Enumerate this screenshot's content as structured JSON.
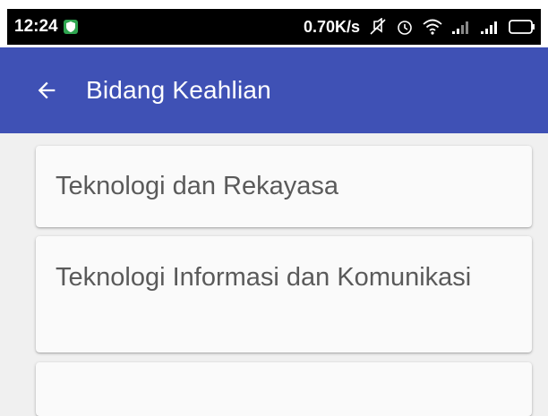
{
  "status_bar": {
    "time": "12:24",
    "net_speed": "0.70K/s",
    "icons": [
      "shield-icon",
      "mute-icon",
      "alarm-icon",
      "wifi-icon",
      "signal-icon",
      "signal-icon",
      "battery-icon"
    ]
  },
  "app_bar": {
    "title": "Bidang Keahlian",
    "back_icon": "arrow-left-icon",
    "color": "#3f51b5"
  },
  "list": {
    "items": [
      {
        "label": "Teknologi dan Rekayasa"
      },
      {
        "label": "Teknologi Informasi dan Komunikasi"
      },
      {
        "label": ""
      }
    ]
  }
}
